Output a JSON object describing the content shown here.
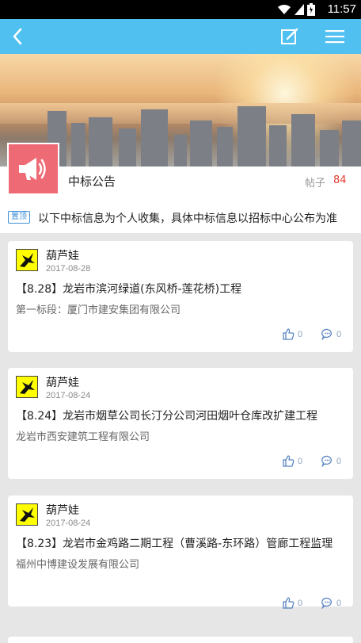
{
  "status_bar": {
    "time": "11:57"
  },
  "forum": {
    "name": "中标公告",
    "post_label": "帖子",
    "post_count": "84"
  },
  "pinned": {
    "badge": "置顶",
    "text": "以下中标信息为个人收集，具体中标信息以招标中心公布为准"
  },
  "posts": [
    {
      "author": "葫芦娃",
      "date": "2017-08-28",
      "title": "【8.28】龙岩市滨河绿道(东风桥-莲花桥)工程",
      "summary": "第一标段：厦门市建安集团有限公司",
      "likes": "0",
      "comments": "0"
    },
    {
      "author": "葫芦娃",
      "date": "2017-08-24",
      "title": "【8.24】龙岩市烟草公司长汀分公司河田烟叶仓库改扩建工程",
      "summary": "龙岩市西安建筑工程有限公司",
      "likes": "0",
      "comments": "0"
    },
    {
      "author": "葫芦娃",
      "date": "2017-08-24",
      "title": "【8.23】龙岩市金鸡路二期工程（曹溪路-东环路）管廊工程监理",
      "summary": "福州中博建设发展有限公司",
      "likes": "0",
      "comments": "0"
    }
  ],
  "colors": {
    "appbar": "#4fc0f0",
    "accent_red": "#e23b2f",
    "forum_icon_bg": "#ee6b76"
  },
  "icons": [
    "back-arrow-icon",
    "edit-icon",
    "menu-icon",
    "megaphone-icon",
    "thumbs-up-icon",
    "comment-icon"
  ]
}
